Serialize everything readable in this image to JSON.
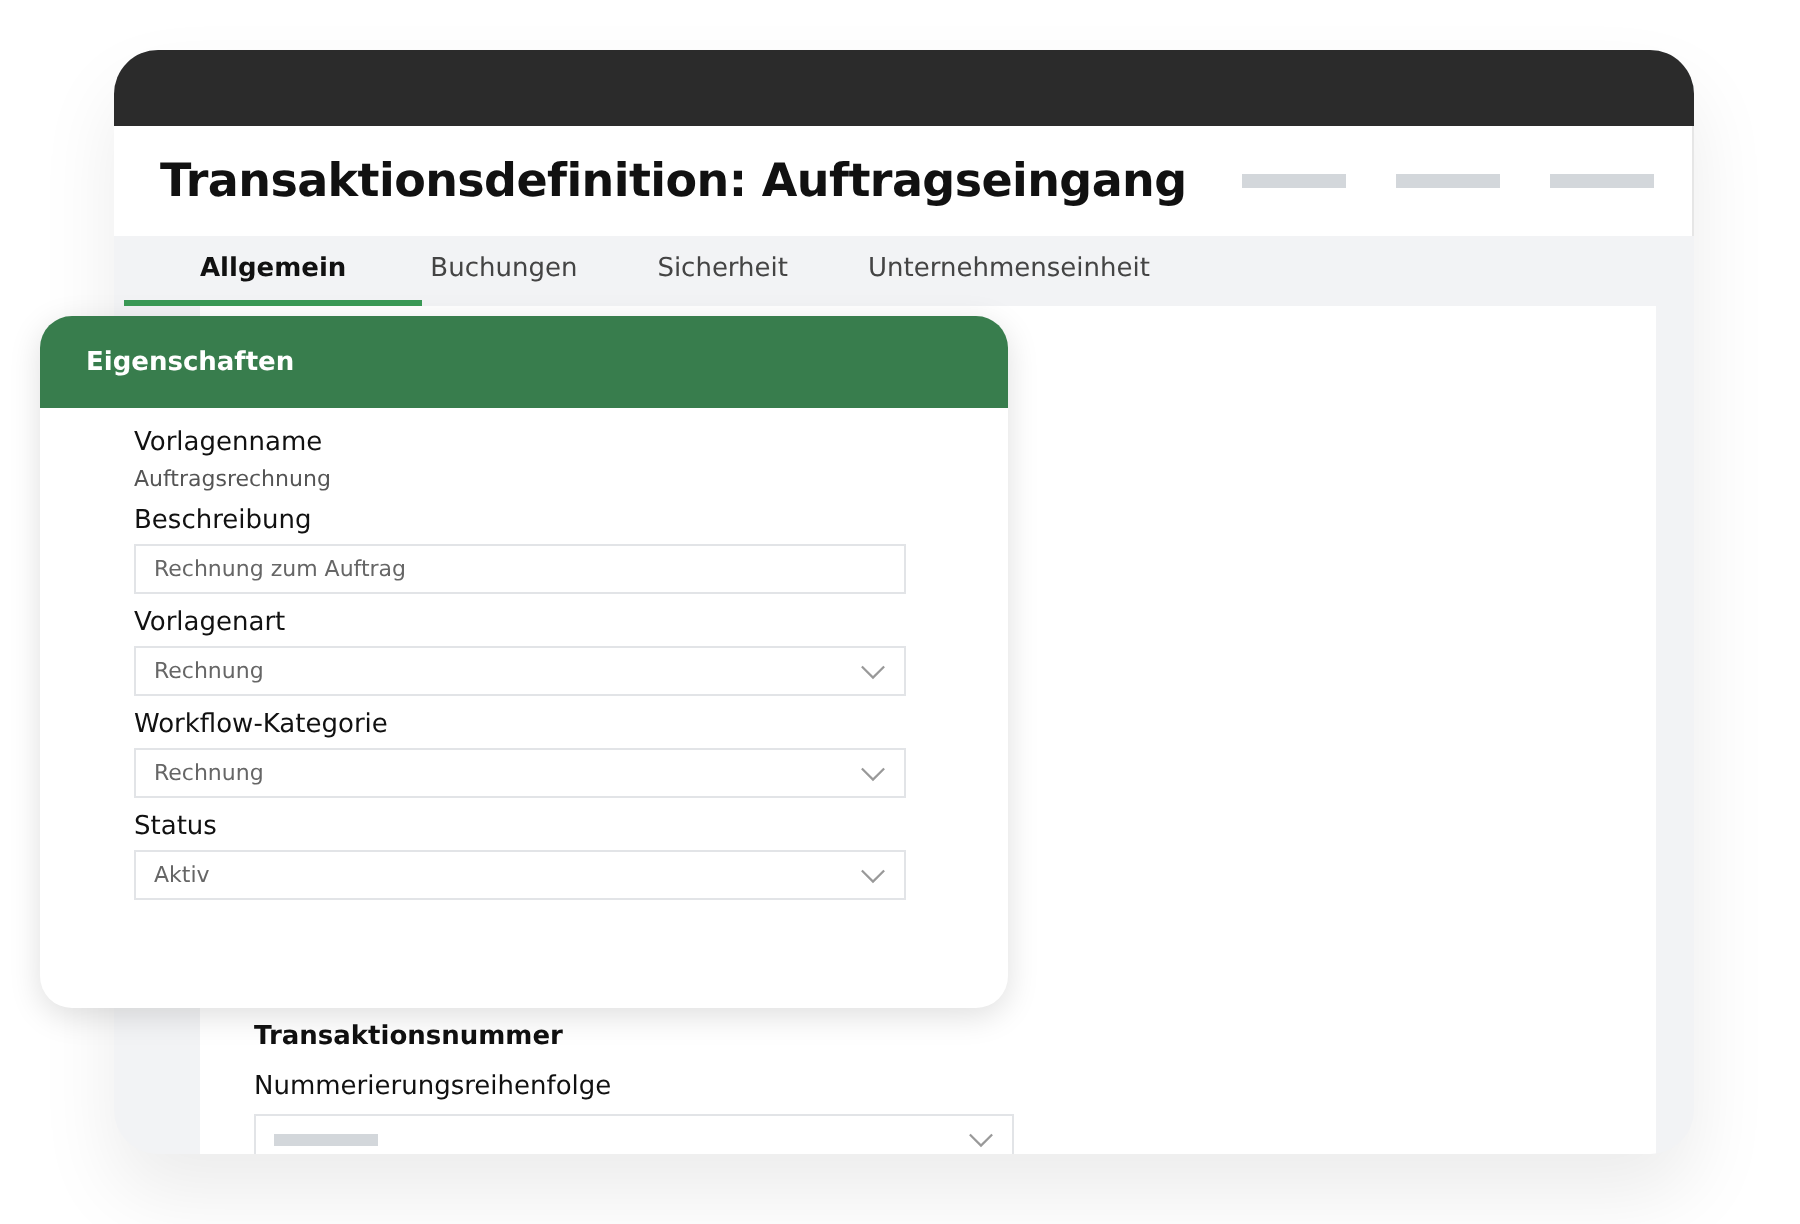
{
  "window": {
    "title": "Transaktionsdefinition: Auftragseingang"
  },
  "tabs": [
    {
      "label": "Allgemein",
      "selected": true
    },
    {
      "label": "Buchungen",
      "selected": false
    },
    {
      "label": "Sicherheit",
      "selected": false
    },
    {
      "label": "Unternehmenseinheit",
      "selected": false
    }
  ],
  "properties_card": {
    "title": "Eigenschaften",
    "fields": [
      {
        "kind": "text",
        "label": "Vorlagenname",
        "value": "Auftragsrechnung"
      },
      {
        "kind": "input",
        "label": "Beschreibung",
        "value": "Rechnung zum Auftrag"
      },
      {
        "kind": "select",
        "label": "Vorlagenart",
        "value": "Rechnung"
      },
      {
        "kind": "select",
        "label": "Workflow-Kategorie",
        "value": "Rechnung"
      },
      {
        "kind": "select",
        "label": "Status",
        "value": "Aktiv"
      }
    ]
  },
  "transaction_number": {
    "title": "Transaktionsnummer",
    "fields": [
      {
        "kind": "select",
        "label": "Nummerierungsreihenfolge"
      }
    ]
  }
}
